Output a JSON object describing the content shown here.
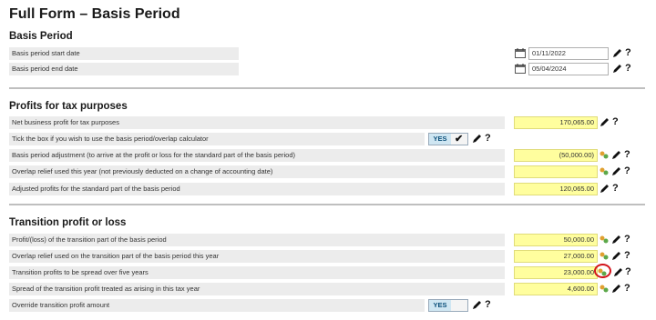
{
  "page": {
    "title": "Full Form – Basis Period"
  },
  "basis_period": {
    "title": "Basis Period",
    "rows": [
      {
        "label": "Basis period start date",
        "date": "01/11/2022"
      },
      {
        "label": "Basis period end date",
        "date": "05/04/2024"
      }
    ]
  },
  "profits": {
    "title": "Profits for tax purposes",
    "net_business_profit": {
      "label": "Net business profit for tax purposes",
      "value": "170,065.00"
    },
    "calculator_toggle": {
      "label": "Tick the box if you wish to use the basis period/overlap calculator",
      "yes_label": "YES",
      "checked_mark": "✔"
    },
    "basis_adjustment": {
      "label": "Basis period adjustment (to arrive at the profit or loss for the standard part of the basis period)",
      "value": "(50,000.00)"
    },
    "overlap_relief": {
      "label": "Overlap relief used this year (not previously deducted on a change of accounting date)",
      "value": ""
    },
    "adjusted_profits": {
      "label": "Adjusted profits for the standard part of the basis period",
      "value": "120,065.00"
    }
  },
  "transition": {
    "title": "Transition profit or loss",
    "profit_loss": {
      "label": "Profit/(loss) of the transition part of the basis period",
      "value": "50,000.00"
    },
    "overlap_relief": {
      "label": "Overlap relief used on the transition part of the basis period this year",
      "value": "27,000.00"
    },
    "spread_five_years": {
      "label": "Transition profits to be spread over five years",
      "value": "23,000.00"
    },
    "spread_this_year": {
      "label": "Spread of the transition profit treated as arising in this tax year",
      "value": "4,600.00"
    },
    "override_toggle": {
      "label": "Override transition profit amount",
      "yes_label": "YES"
    }
  },
  "icons": {
    "help_glyph": "?",
    "accent": "#fffe9e",
    "annotation_circle": "#d3141c"
  }
}
